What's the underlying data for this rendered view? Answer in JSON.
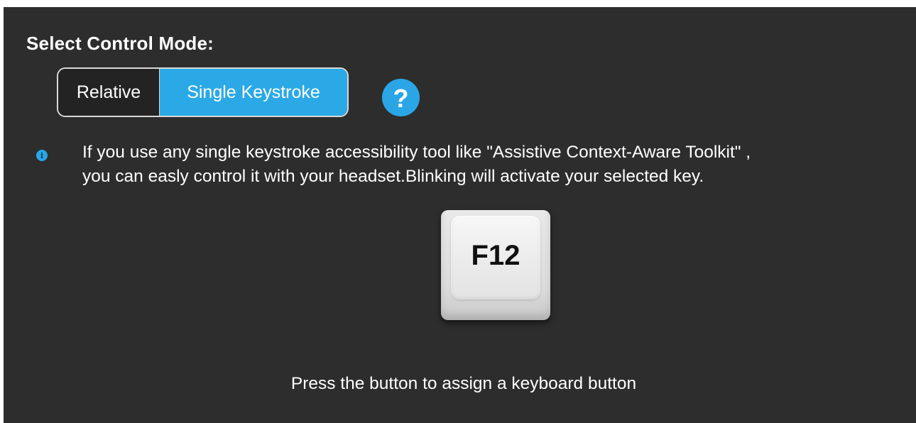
{
  "title": "Select Control Mode:",
  "mode_selector": {
    "options": [
      "Relative",
      "Single Keystroke"
    ],
    "selected": "Single Keystroke"
  },
  "help_button": {
    "icon": "question-mark-icon",
    "glyph": "?"
  },
  "info": {
    "icon": "info-icon",
    "glyph": "i",
    "line1": "If you use any single keystroke accessibility tool like \"Assistive Context-Aware Toolkit\" ,",
    "line2": "you can easly control it with your headset.Blinking will activate your selected key."
  },
  "key_button": {
    "label": "F12"
  },
  "hint": "Press the button to assign a keyboard button",
  "colors": {
    "background": "#2d2d2d",
    "accent": "#2aa9e6",
    "text": "#ffffff"
  }
}
